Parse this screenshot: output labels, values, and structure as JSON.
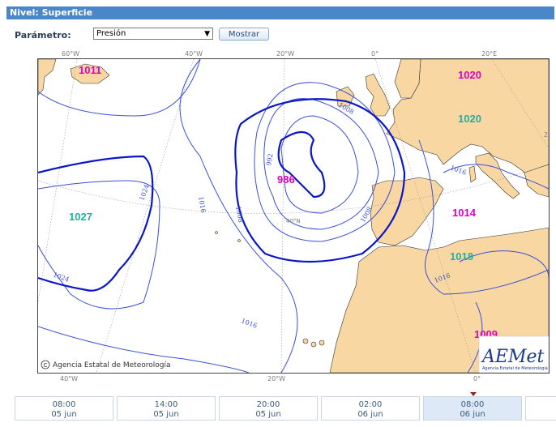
{
  "header": {
    "title": "Nivel: Superficie"
  },
  "form": {
    "label": "Parámetro:",
    "selected": "Presión",
    "button": "Mostrar"
  },
  "map": {
    "top_longitudes": [
      "60°W",
      "40°W",
      "20°W",
      "0°",
      "20°E"
    ],
    "bottom_longitudes": [
      "40°W",
      "20°W",
      "0°"
    ],
    "lat_label": "40°N",
    "right_edge_label": "2",
    "highs": [
      "1027",
      "1020",
      "1018"
    ],
    "pressure_labels": [
      {
        "text": "1011",
        "color": "#e000c0"
      },
      {
        "text": "1020",
        "color": "#e000c0"
      },
      {
        "text": "1020",
        "color": "#20b0a0"
      },
      {
        "text": "1027",
        "color": "#20b0a0"
      },
      {
        "text": "986",
        "color": "#e000c0"
      },
      {
        "text": "1014",
        "color": "#e000c0"
      },
      {
        "text": "1018",
        "color": "#20b0a0"
      },
      {
        "text": "1009",
        "color": "#e000c0"
      }
    ],
    "isobar_labels": [
      "1024",
      "1024",
      "1016",
      "1008",
      "992",
      "1008",
      "1008",
      "1016",
      "1016",
      "1016"
    ],
    "credit": "Agencia Estatal de Meteorología",
    "credit_symbol": "C",
    "logo_text": "AEMet",
    "logo_sub": "Agencia Estatal de Meteorología",
    "colors": {
      "land": "#f8d7a3",
      "isobar": "#3a4fd8",
      "major_isobar": "#0a16c8"
    }
  },
  "timeline": [
    {
      "time": "08:00",
      "date": "05 jun"
    },
    {
      "time": "14:00",
      "date": "05 jun"
    },
    {
      "time": "20:00",
      "date": "05 jun"
    },
    {
      "time": "02:00",
      "date": "06 jun"
    },
    {
      "time": "08:00",
      "date": "06 jun"
    }
  ],
  "timeline_active_index": 4
}
